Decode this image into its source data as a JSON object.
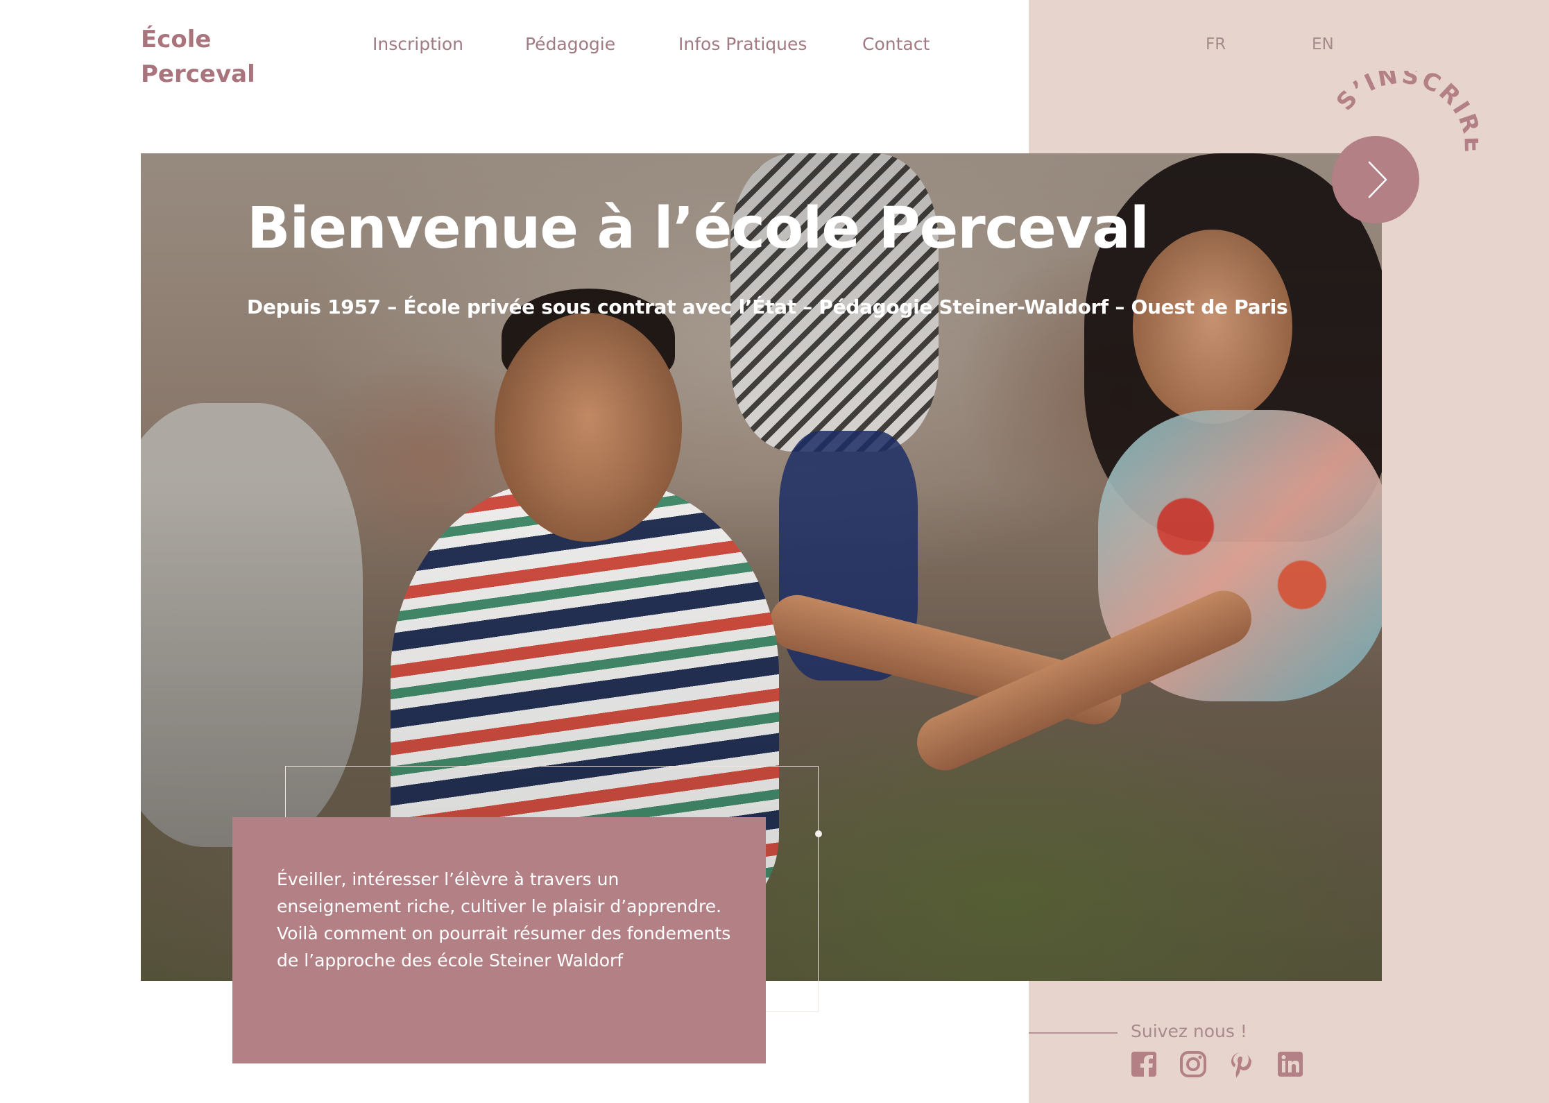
{
  "brand": {
    "logo_line1": "École",
    "logo_line2": "Perceval"
  },
  "nav": {
    "items": [
      {
        "label": "Inscription"
      },
      {
        "label": "Pédagogie"
      },
      {
        "label": "Infos Pratiques"
      },
      {
        "label": "Contact"
      }
    ]
  },
  "languages": {
    "fr": "FR",
    "en": "EN"
  },
  "hero": {
    "title": "Bienvenue à l’école Perceval",
    "subtitle": "Depuis 1957 – École privée sous contrat avec l’État – Pédagogie Steiner-Waldorf – Ouest de Paris",
    "image_icon": "children-playing-photo"
  },
  "intro": {
    "text": "Éveiller, intéresser l’élèvre à travers un enseignement riche, cultiver le plaisir d’apprendre. Voilà comment on pourrait résumer  des fondements de l’approche des école Steiner Waldorf"
  },
  "cta": {
    "label": "S’INSCRIRE",
    "icon": "chevron-right-icon"
  },
  "social": {
    "label": "Suivez nous !",
    "icons": [
      "facebook-icon",
      "instagram-icon",
      "pinterest-icon",
      "linkedin-icon"
    ]
  },
  "colors": {
    "accent": "#b28085",
    "side_panel": "#e7d5cd",
    "logo": "#a9747c",
    "nav_text": "#a17b81",
    "white": "#ffffff"
  }
}
